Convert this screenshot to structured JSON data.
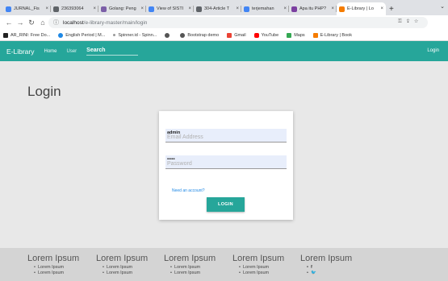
{
  "browser": {
    "tabs": [
      {
        "label": "JURNAL_Fis",
        "color": "#4285f4"
      },
      {
        "label": "236393064",
        "color": "#5f6368"
      },
      {
        "label": "Golang: Peng",
        "color": "#7b5ea7"
      },
      {
        "label": "View of SISTI",
        "color": "#4285f4"
      },
      {
        "label": "304-Article T",
        "color": "#5f6368"
      },
      {
        "label": "terjemahan",
        "color": "#4285f4"
      },
      {
        "label": "Apa itu PHP?",
        "color": "#7b3fa0"
      },
      {
        "label": "E-Library | Lo",
        "color": "#f57c00",
        "active": true
      }
    ],
    "new_tab": "+",
    "url_host": "localhost",
    "url_path": "/e-library-master/main/login",
    "bookmarks": [
      {
        "label": "AR_RINI: Free Do...",
        "color": "#222222"
      },
      {
        "label": "English Period | M...",
        "color": "#1e88e5"
      },
      {
        "label": "Spinner.id - Spinn...",
        "color": "#999999"
      },
      {
        "label": "",
        "color": "#555555"
      },
      {
        "label": "Bootstrap demo",
        "color": "#555555"
      },
      {
        "label": "Gmail",
        "color": "#ea4335"
      },
      {
        "label": "YouTube",
        "color": "#ff0000"
      },
      {
        "label": "Maps",
        "color": "#34a853"
      },
      {
        "label": "E-Library | Book",
        "color": "#f57c00"
      }
    ]
  },
  "navbar": {
    "brand": "E-Library",
    "links": [
      "Home",
      "User"
    ],
    "search_label": "Search",
    "login_label": "Login",
    "accent": "#26a69a"
  },
  "main": {
    "title": "Login",
    "form": {
      "email_value": "admin",
      "email_placeholder": "Email Address",
      "password_value": "•••••",
      "password_placeholder": "Password",
      "need_account": "Need an account?",
      "login_button": "LOGIN"
    }
  },
  "footer": {
    "columns": [
      {
        "heading": "Lorem Ipsum",
        "items": [
          "Lorem Ipsum",
          "Lorem Ipsum"
        ]
      },
      {
        "heading": "Lorem Ipsum",
        "items": [
          "Lorem Ipsum",
          "Lorem Ipsum"
        ]
      },
      {
        "heading": "Lorem Ipsum",
        "items": [
          "Lorem Ipsum",
          "Lorem Ipsum"
        ]
      },
      {
        "heading": "Lorem Ipsum",
        "items": [
          "Lorem Ipsum",
          "Lorem Ipsum"
        ]
      },
      {
        "heading": "Lorem Ipsum",
        "items": [
          "f",
          "🐦"
        ]
      }
    ]
  }
}
